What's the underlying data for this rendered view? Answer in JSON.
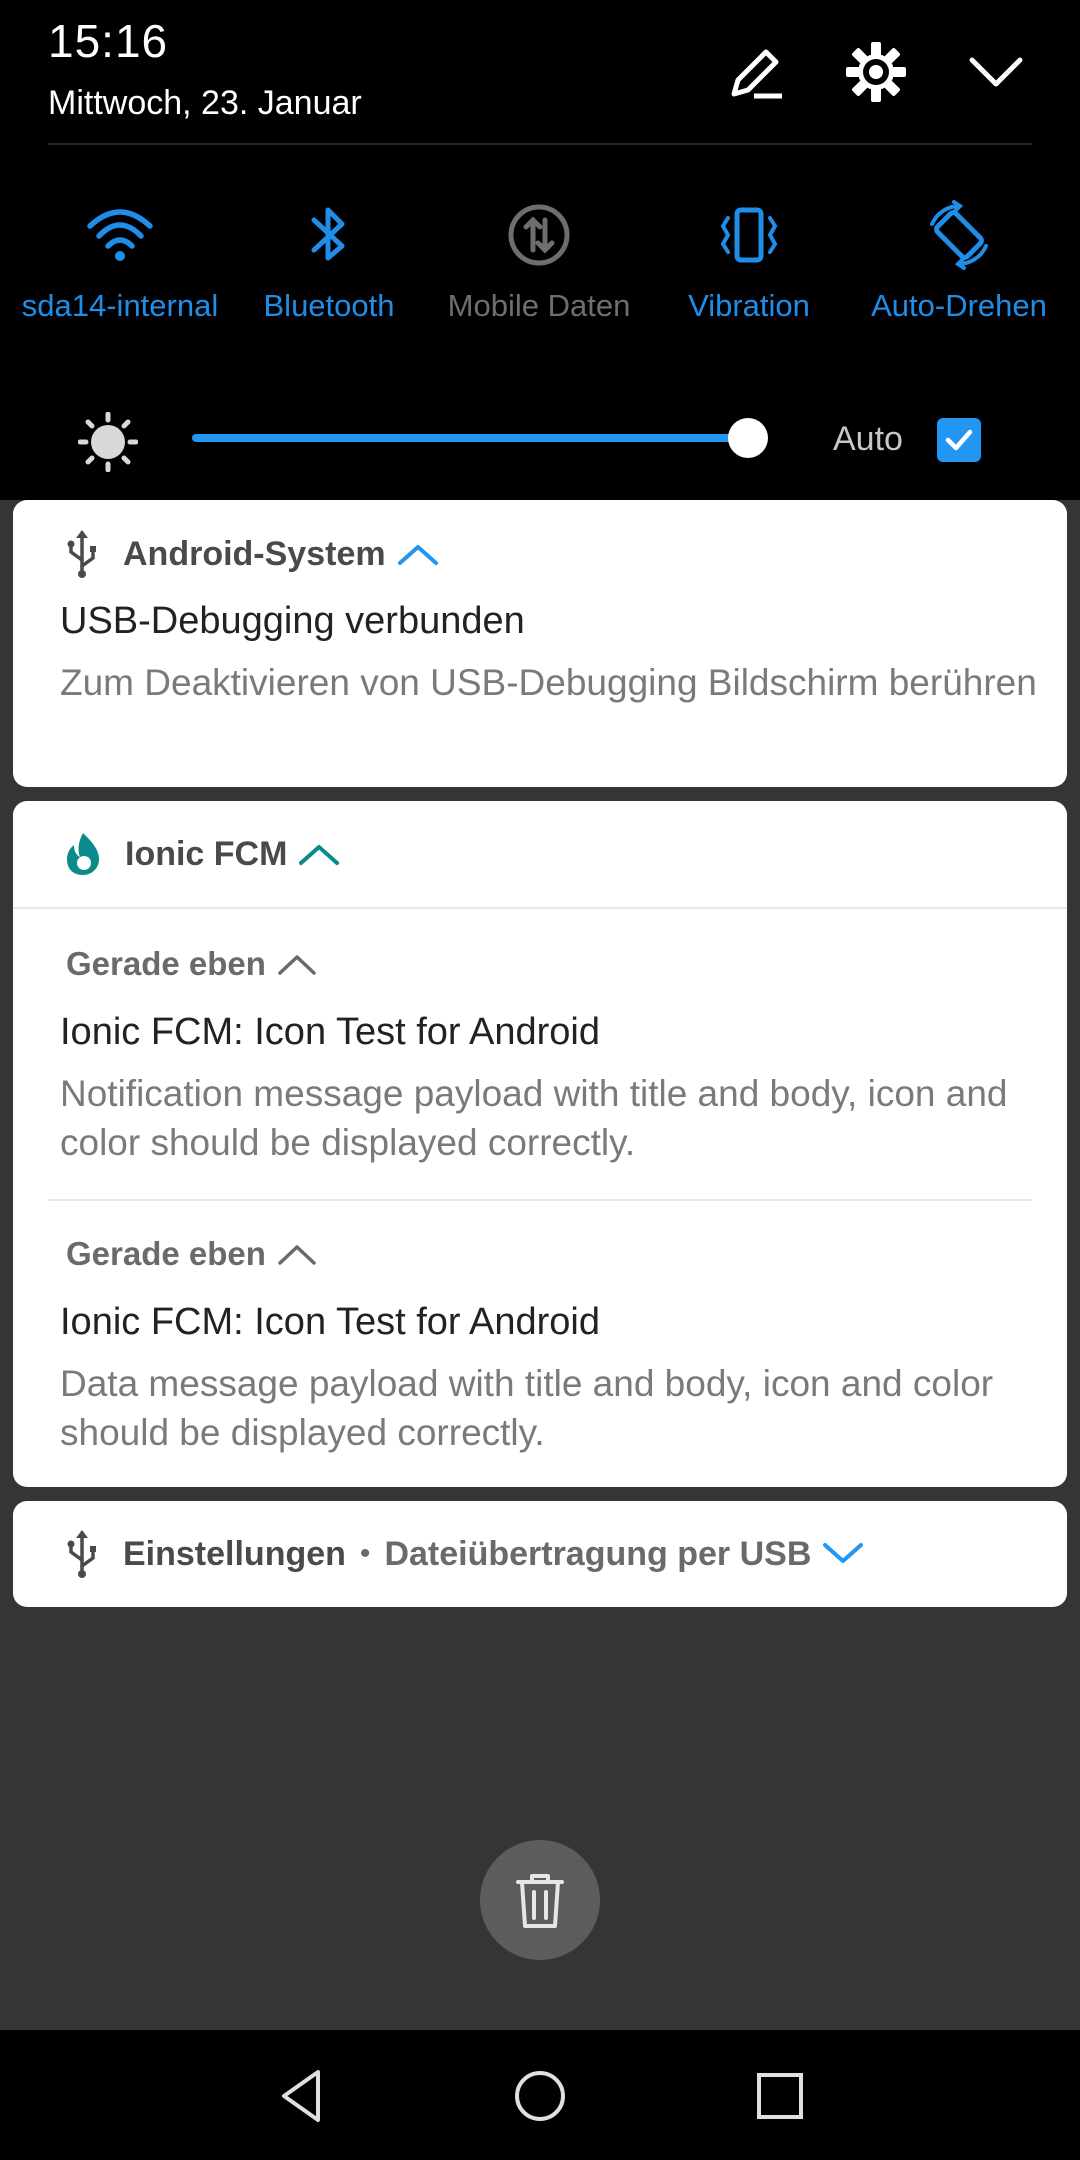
{
  "status": {
    "time": "15:16",
    "date": "Mittwoch, 23. Januar"
  },
  "quick_tiles": [
    {
      "label": "sda14-internal",
      "icon": "wifi-icon",
      "active": true
    },
    {
      "label": "Bluetooth",
      "icon": "bluetooth-icon",
      "active": true
    },
    {
      "label": "Mobile Daten",
      "icon": "mobile-data-icon",
      "active": false
    },
    {
      "label": "Vibration",
      "icon": "vibration-icon",
      "active": true
    },
    {
      "label": "Auto-Drehen",
      "icon": "auto-rotate-icon",
      "active": true
    }
  ],
  "brightness": {
    "level_percent": 100,
    "auto_label": "Auto",
    "auto_checked": true
  },
  "notifications": {
    "android_system": {
      "app": "Android-System",
      "title": "USB-Debugging verbunden",
      "body": "Zum Deaktivieren von USB-Debugging Bildschirm berühren"
    },
    "ionic_fcm": {
      "app": "Ionic FCM",
      "messages": [
        {
          "time": "Gerade eben",
          "title": "Ionic FCM: Icon Test for Android",
          "body": "Notification message payload with title and body, icon and color should be displayed correctly."
        },
        {
          "time": "Gerade eben",
          "title": "Ionic FCM: Icon Test for Android",
          "body": "Data message payload with title and body, icon and color should be displayed correctly."
        }
      ]
    },
    "settings": {
      "app": "Einstellungen",
      "separator": "•",
      "summary": "Dateiübertragung per USB"
    }
  },
  "colors": {
    "accent": "#2196f3",
    "ionic_teal": "#0a8a8a",
    "shade": "#000000",
    "background": "#353535"
  }
}
